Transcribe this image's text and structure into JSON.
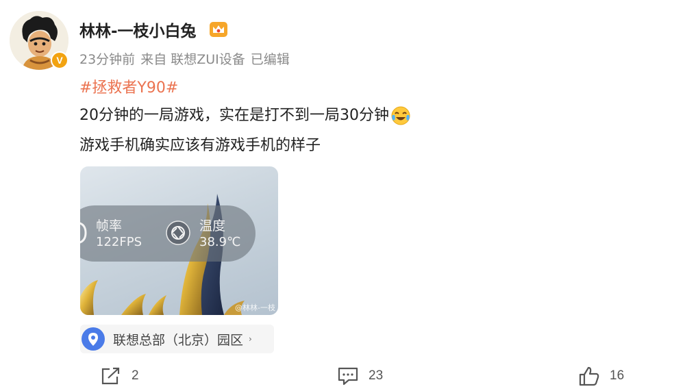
{
  "author": {
    "name": "林林-一枝小白兔",
    "verified_badge": "V"
  },
  "meta": {
    "time": "23分钟前",
    "source": "来自 联想ZUI设备",
    "edited": "已编辑"
  },
  "post": {
    "hashtag": "#拯救者Y90#",
    "line1": "20分钟的一局游戏，实在是打不到一局30分钟",
    "line2": "游戏手机确实应该有游戏手机的样子",
    "emoji": "laugh-cry-emoji"
  },
  "image": {
    "fps_label": "帧率",
    "fps_value": "122FPS",
    "temp_label": "温度",
    "temp_value": "38.9℃",
    "watermark": "@林林-一枝"
  },
  "location": {
    "text": "联想总部（北京）园区",
    "arrow": "›"
  },
  "actions": {
    "repost_count": "2",
    "comment_count": "23",
    "like_count": "16"
  },
  "colors": {
    "hashtag": "#eb7350",
    "verified": "#f2a311",
    "location_pin": "#4a7be8"
  }
}
